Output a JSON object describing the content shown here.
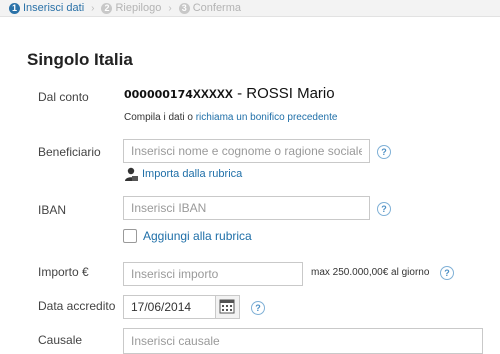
{
  "steps": [
    {
      "num": "1",
      "label": "Inserisci dati"
    },
    {
      "num": "2",
      "label": "Riepilogo"
    },
    {
      "num": "3",
      "label": "Conferma"
    }
  ],
  "page_title": "Singolo Italia",
  "form": {
    "account": {
      "label": "Dal conto",
      "number": "000000174",
      "mask": "XXXXX",
      "holder": " - ROSSI Mario"
    },
    "hint": {
      "prefix": "Compila i dati o ",
      "link": "richiama un bonifico precedente"
    },
    "beneficiary": {
      "label": "Beneficiario",
      "placeholder": "Inserisci nome e cognome o ragione sociale",
      "import_link": "Importa dalla rubrica"
    },
    "iban": {
      "label": "IBAN",
      "placeholder": "Inserisci IBAN",
      "add_link": "Aggiungi alla rubrica"
    },
    "amount": {
      "label": "Importo €",
      "placeholder": "Inserisci importo",
      "max_note": "max 250.000,00€ al giorno"
    },
    "date": {
      "label": "Data accredito",
      "value": "17/06/2014"
    },
    "causale": {
      "label": "Causale",
      "placeholder": "Inserisci causale"
    }
  },
  "icons": {
    "help": "?",
    "separator": "›",
    "help_color": "#4b8ec4",
    "accent": "#2b72a8",
    "link_color": "#1f6fa8"
  }
}
